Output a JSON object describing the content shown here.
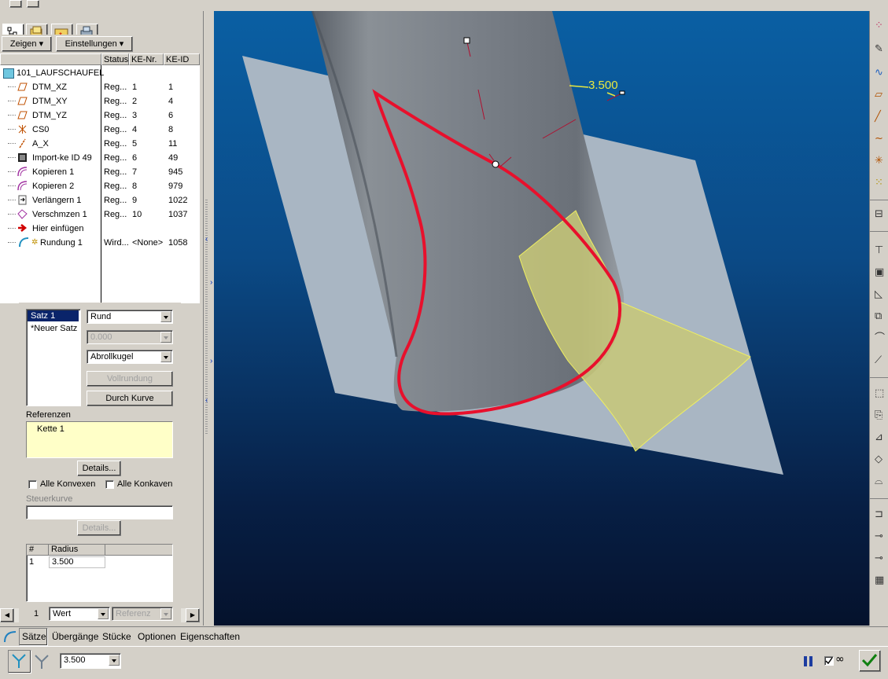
{
  "toolbar": {
    "zeigen": "Zeigen",
    "einstellungen": "Einstellungen"
  },
  "tree": {
    "columns": [
      "Status",
      "KE-Nr.",
      "KE-ID"
    ],
    "root": "101_LAUFSCHAUFEL",
    "rows": [
      {
        "name": "DTM_XZ",
        "status": "Reg...",
        "nr": "1",
        "id": "1",
        "icon": "datum-plane-icon"
      },
      {
        "name": "DTM_XY",
        "status": "Reg...",
        "nr": "2",
        "id": "4",
        "icon": "datum-plane-icon"
      },
      {
        "name": "DTM_YZ",
        "status": "Reg...",
        "nr": "3",
        "id": "6",
        "icon": "datum-plane-icon"
      },
      {
        "name": "CS0",
        "status": "Reg...",
        "nr": "4",
        "id": "8",
        "icon": "coordinate-system-icon"
      },
      {
        "name": "A_X",
        "status": "Reg...",
        "nr": "5",
        "id": "11",
        "icon": "datum-axis-icon"
      },
      {
        "name": "Import-ke ID 49",
        "status": "Reg...",
        "nr": "6",
        "id": "49",
        "icon": "import-feature-icon"
      },
      {
        "name": "Kopieren 1",
        "status": "Reg...",
        "nr": "7",
        "id": "945",
        "icon": "copy-surface-icon"
      },
      {
        "name": "Kopieren 2",
        "status": "Reg...",
        "nr": "8",
        "id": "979",
        "icon": "copy-surface-icon"
      },
      {
        "name": "Verlängern 1",
        "status": "Reg...",
        "nr": "9",
        "id": "1022",
        "icon": "extend-icon"
      },
      {
        "name": "Verschmzen 1",
        "status": "Reg...",
        "nr": "10",
        "id": "1037",
        "icon": "merge-icon"
      },
      {
        "name": "Hier einfügen",
        "status": "",
        "nr": "",
        "id": "",
        "icon": "insert-here-arrow-icon"
      },
      {
        "name": "Rundung 1",
        "status": "Wird...",
        "nr": "<None>",
        "id": "1058",
        "icon": "round-icon"
      }
    ]
  },
  "panel": {
    "sets": [
      "Satz 1",
      "*Neuer Satz"
    ],
    "shape": "Rund",
    "value_disabled": "0.000",
    "method": "Abrollkugel",
    "vollrundung": "Vollrundung",
    "durch_kurve": "Durch Kurve",
    "referenzen_label": "Referenzen",
    "referenzen_item": "Kette 1",
    "details": "Details...",
    "alle_konvexen": "Alle Konvexen",
    "alle_konkaven": "Alle Konkaven",
    "steuerkurve": "Steuerkurve",
    "details2": "Details...",
    "table_headers": [
      "#",
      "Radius"
    ],
    "table_row": {
      "num": "1",
      "radius": "3.500"
    },
    "footer_num": "1",
    "footer_wert": "Wert",
    "footer_ref": "Referenz"
  },
  "viewport": {
    "dimension": "3.500"
  },
  "bottom_tabs": [
    "Sätze",
    "Übergänge",
    "Stücke",
    "Optionen",
    "Eigenschaften"
  ],
  "dashboard": {
    "radius_value": "3.500"
  },
  "colors": {
    "curve": "#e8102c",
    "fillet_surface": "#c8c878",
    "selection": "#0a246a"
  }
}
